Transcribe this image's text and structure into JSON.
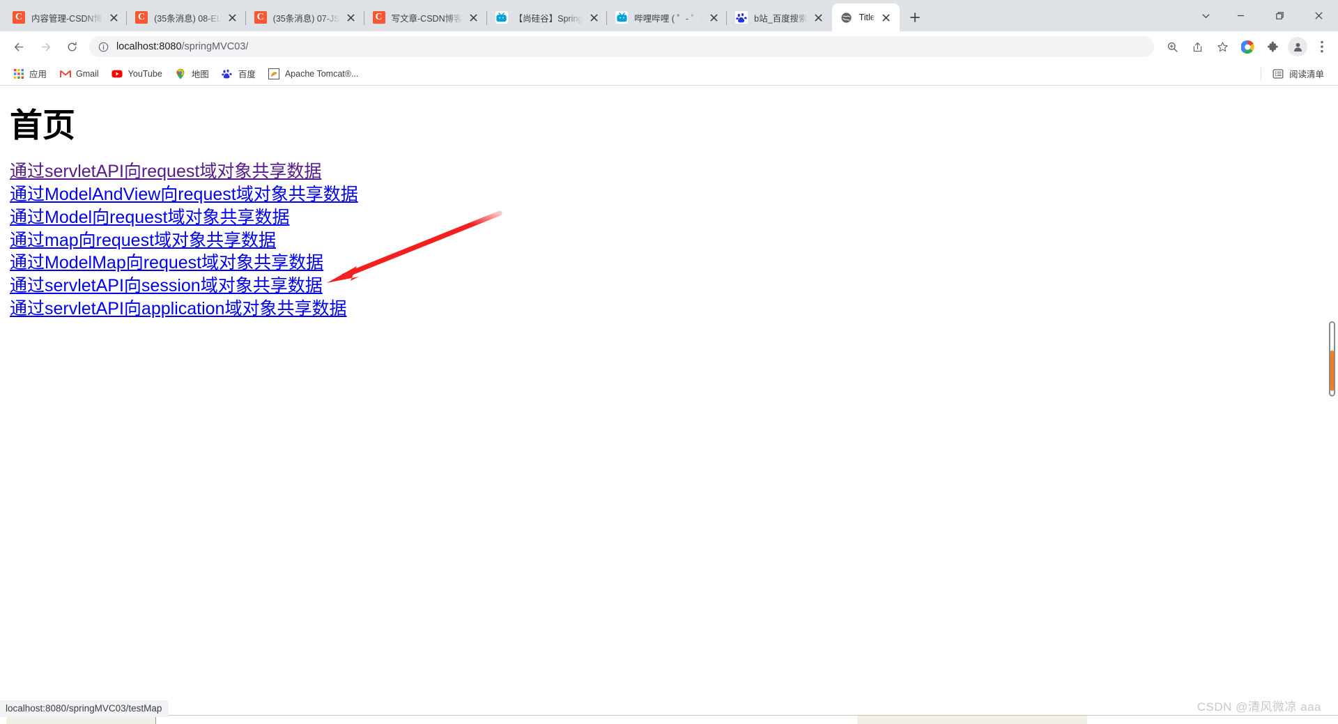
{
  "window": {
    "controls": {
      "tab_search": "tab-search",
      "minimize": "minimize",
      "restore": "restore",
      "close": "close"
    }
  },
  "tabstrip": {
    "new_tab_label": "+",
    "tabs": [
      {
        "title": "内容管理-CSDN博",
        "favicon": "csdn-icon",
        "active": false
      },
      {
        "title": "(35条消息) 08-EL",
        "favicon": "csdn-icon",
        "active": false
      },
      {
        "title": "(35条消息) 07-JS",
        "favicon": "csdn-icon",
        "active": false
      },
      {
        "title": "写文章-CSDN博客",
        "favicon": "csdn-icon",
        "active": false
      },
      {
        "title": "【尚硅谷】Spring",
        "favicon": "bilibili-icon",
        "active": false
      },
      {
        "title": "哔哩哔哩 ( ゜- ゜)",
        "favicon": "bilibili-icon",
        "active": false
      },
      {
        "title": "b站_百度搜索",
        "favicon": "baidu-icon",
        "active": false
      },
      {
        "title": "Title",
        "favicon": "globe-icon",
        "active": true
      }
    ]
  },
  "toolbar": {
    "back": "back",
    "forward": "forward",
    "reload": "reload",
    "omnibox": {
      "site_info_icon": "info-circle-icon",
      "url_host": "localhost:8080",
      "url_path": "/springMVC03/",
      "url_full": "localhost:8080/springMVC03/"
    },
    "actions": [
      {
        "name": "zoom-in-icon"
      },
      {
        "name": "share-icon"
      },
      {
        "name": "star-bookmark-icon"
      },
      {
        "name": "google-apps-icon"
      },
      {
        "name": "extensions-puzzle-icon"
      },
      {
        "name": "profile-avatar-icon"
      },
      {
        "name": "more-vertical-icon"
      }
    ]
  },
  "bookmarks": {
    "items": [
      {
        "label": "应用",
        "icon": "apps-grid-icon"
      },
      {
        "label": "Gmail",
        "icon": "gmail-icon"
      },
      {
        "label": "YouTube",
        "icon": "youtube-icon"
      },
      {
        "label": "地图",
        "icon": "maps-pin-icon"
      },
      {
        "label": "百度",
        "icon": "baidu-icon"
      },
      {
        "label": "Apache Tomcat®...",
        "icon": "tomcat-icon"
      }
    ],
    "reading_list": {
      "label": "阅读清单",
      "icon": "reading-list-icon"
    }
  },
  "page": {
    "heading": "首页",
    "links": [
      {
        "text": "通过servletAPI向request域对象共享数据",
        "visited": true
      },
      {
        "text": "通过ModelAndView向request域对象共享数据",
        "visited": false
      },
      {
        "text": "通过Model向request域对象共享数据",
        "visited": false
      },
      {
        "text": "通过map向request域对象共享数据",
        "visited": false
      },
      {
        "text": "通过ModelMap向request域对象共享数据",
        "visited": false
      },
      {
        "text": "通过servletAPI向session域对象共享数据",
        "visited": false
      },
      {
        "text": "通过servletAPI向application域对象共享数据",
        "visited": false
      }
    ],
    "annotation": {
      "name": "red-arrow-annotation",
      "color": "#f42020"
    },
    "link_color": "#0000ee",
    "visited_link_color": "#551a8b"
  },
  "status_bar": {
    "text": "localhost:8080/springMVC03/testMap"
  },
  "watermark": {
    "text": "CSDN @清风微凉 aaa"
  },
  "scrollbar": {
    "thumb_color": "#f07c1e"
  }
}
